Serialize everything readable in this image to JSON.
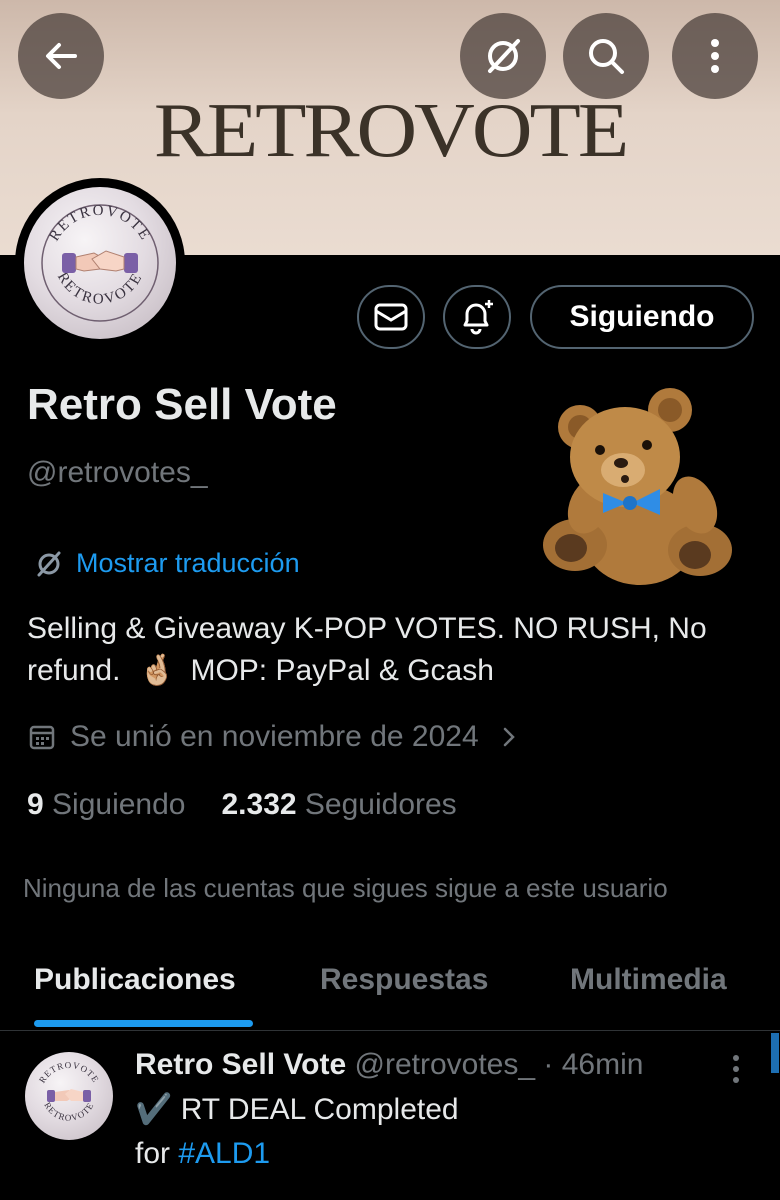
{
  "banner": {
    "logo_text": "RETROVOTE"
  },
  "header_buttons": {
    "back": "back-arrow-icon",
    "translate": "translate-icon",
    "search": "search-icon",
    "more": "more-vertical-icon"
  },
  "avatar": {
    "ring_text": "RETROVOTE"
  },
  "actions": {
    "follow_label": "Siguiendo"
  },
  "profile": {
    "name": "Retro Sell Vote",
    "handle": "@retrovotes_",
    "translate_label": "Mostrar traducción",
    "bio_line1": "Selling & Giveaway K-POP VOTES. NO RUSH, No",
    "bio_line2_a": "refund.",
    "bio_emoji": "🤞🏼",
    "bio_line2_b": "MOP: PayPal & Gcash",
    "joined": "Se unió en noviembre de 2024",
    "following_count": "9",
    "following_label": "Siguiendo",
    "followers_count": "2.332",
    "followers_label": "Seguidores",
    "mutual_note": "Ninguna de las cuentas que sigues sigue a este usuario"
  },
  "tabs": [
    {
      "label": "Publicaciones",
      "active": true
    },
    {
      "label": "Respuestas",
      "active": false
    },
    {
      "label": "Multimedia",
      "active": false
    }
  ],
  "post": {
    "author": "Retro Sell Vote",
    "handle": "@retrovotes_",
    "time": "· 46min",
    "line1": "✔️ RT DEAL Completed",
    "line2_prefix": "for",
    "hashtag": "#ALD1"
  },
  "colors": {
    "accent": "#1d9bf0",
    "muted": "#71767b",
    "background": "#000000"
  }
}
